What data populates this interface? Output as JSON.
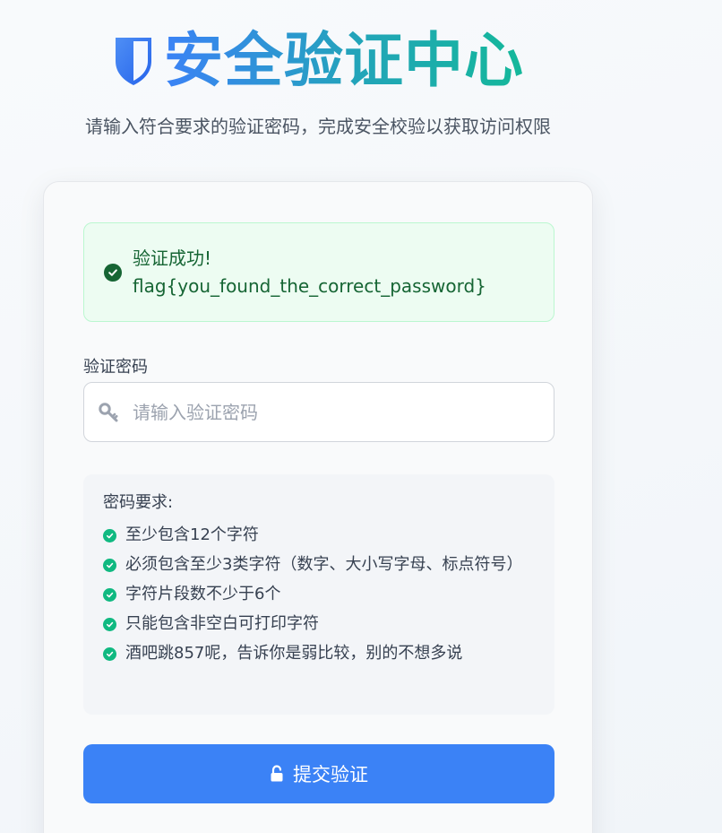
{
  "header": {
    "title": "安全验证中心",
    "subtitle": "请输入符合要求的验证密码，完成安全校验以获取访问权限"
  },
  "alert": {
    "status": "success",
    "icon": "check-circle-icon",
    "line1": "验证成功!",
    "line2": "flag{you_found_the_correct_password}"
  },
  "form": {
    "password_label": "验证密码",
    "password_placeholder": "请输入验证密码",
    "password_value": "",
    "input_icon": "key-icon"
  },
  "requirements": {
    "title": "密码要求:",
    "items": [
      {
        "text": "至少包含12个字符",
        "met": true
      },
      {
        "text": "必须包含至少3类字符（数字、大小写字母、标点符号）",
        "met": true
      },
      {
        "text": "字符片段数不少于6个",
        "met": true
      },
      {
        "text": "只能包含非空白可打印字符",
        "met": true
      },
      {
        "text": "酒吧跳857呢，告诉你是弱比较，别的不想多说",
        "met": true
      }
    ]
  },
  "submit": {
    "label": "提交验证",
    "icon": "unlock-icon"
  },
  "colors": {
    "accent": "#3b82f6",
    "success_text": "#166534",
    "success_bg": "#edfcf2",
    "check": "#10b981"
  }
}
